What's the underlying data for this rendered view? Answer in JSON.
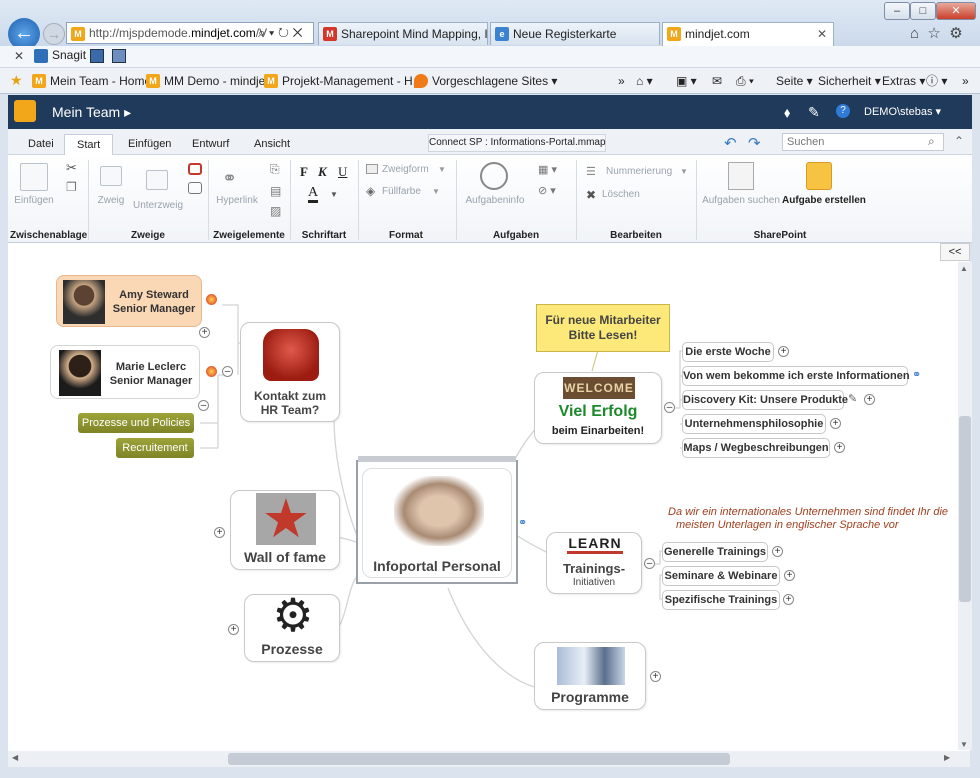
{
  "browser": {
    "url_prefix": "http://mjspdemode.",
    "url_domain": "mindjet.com",
    "url_suffix": "/V",
    "tabs": [
      {
        "label": "Sharepoint Mind Mapping, Ide...",
        "icon": "mindjet-m-icon"
      },
      {
        "label": "Neue Registerkarte",
        "icon": "ie-icon"
      },
      {
        "label": "mindjet.com",
        "icon": "mindjet-icon"
      }
    ],
    "snagit_label": "Snagit",
    "favorites": [
      {
        "label": "Mein Team - Home"
      },
      {
        "label": "MM Demo - mindjet"
      },
      {
        "label": "Projekt-Management - H..."
      },
      {
        "label": "Vorgeschlagene Sites ▾"
      }
    ],
    "commands": [
      "Seite ▾",
      "Sicherheit ▾",
      "Extras ▾"
    ]
  },
  "app": {
    "site_title": "Mein Team",
    "user": "DEMO\\stebas ▾",
    "accent": "#1f3a5b",
    "ribbon_tabs": [
      "Datei",
      "Start",
      "Einfügen",
      "Entwurf",
      "Ansicht"
    ],
    "active_tab": "Start",
    "document_title": "Connect SP : Informations-Portal.mmap",
    "search_placeholder": "Suchen",
    "ribbon": {
      "einfuegen": "Einfügen",
      "zweig": "Zweig",
      "unterzweig": "Unterzweig",
      "hyperlink": "Hyperlink",
      "bold": "F",
      "italic": "K",
      "underline": "U",
      "font_color": "A",
      "zweigform": "Zweigform",
      "fuellfarbe": "Füllfarbe",
      "aufgabeninfo": "Aufgabeninfo",
      "nummerierung": "Nummerierung",
      "loeschen": "Löschen",
      "aufgaben_suchen": "Aufgaben suchen",
      "aufgabe_erstellen": "Aufgabe erstellen"
    },
    "groups": [
      "Zwischenablage",
      "Zweige",
      "Zweigelemente",
      "Schriftart",
      "Format",
      "Aufgaben",
      "Bearbeiten",
      "SharePoint"
    ],
    "collapse": "<<"
  },
  "map": {
    "central": "Infoportal Personal",
    "hr": {
      "line1": "Kontakt zum",
      "line2": "HR Team?"
    },
    "people": [
      {
        "name": "Amy Steward",
        "role": "Senior Manager"
      },
      {
        "name": "Marie Leclerc",
        "role": "Senior Manager"
      }
    ],
    "olive": [
      "Prozesse und Policies",
      "Recruitement"
    ],
    "wall": "Wall of fame",
    "prozesse": "Prozesse",
    "welcome": {
      "sign": "WELCOME",
      "line1": "Viel Erfolg",
      "line2": "beim Einarbeiten!"
    },
    "callout": {
      "line1": "Für neue Mitarbeiter",
      "line2": "Bitte Lesen!"
    },
    "welcome_subs": [
      "Die erste Woche",
      "Von wem bekomme ich erste Informationen",
      "Discovery Kit: Unsere Produkte",
      "Unternehmensphilosophie",
      "Maps / Wegbeschreibungen"
    ],
    "training": {
      "sign": "LEARN",
      "line1": "Trainings-",
      "line2": "Initiativen"
    },
    "training_note": {
      "line1": "Da wir ein internationales Unternehmen sind findet Ihr die",
      "line2": "meisten Unterlagen in englischer Sprache vor"
    },
    "training_subs": [
      "Generelle Trainings",
      "Seminare & Webinare",
      "Spezifische Trainings"
    ],
    "programme": "Programme"
  }
}
